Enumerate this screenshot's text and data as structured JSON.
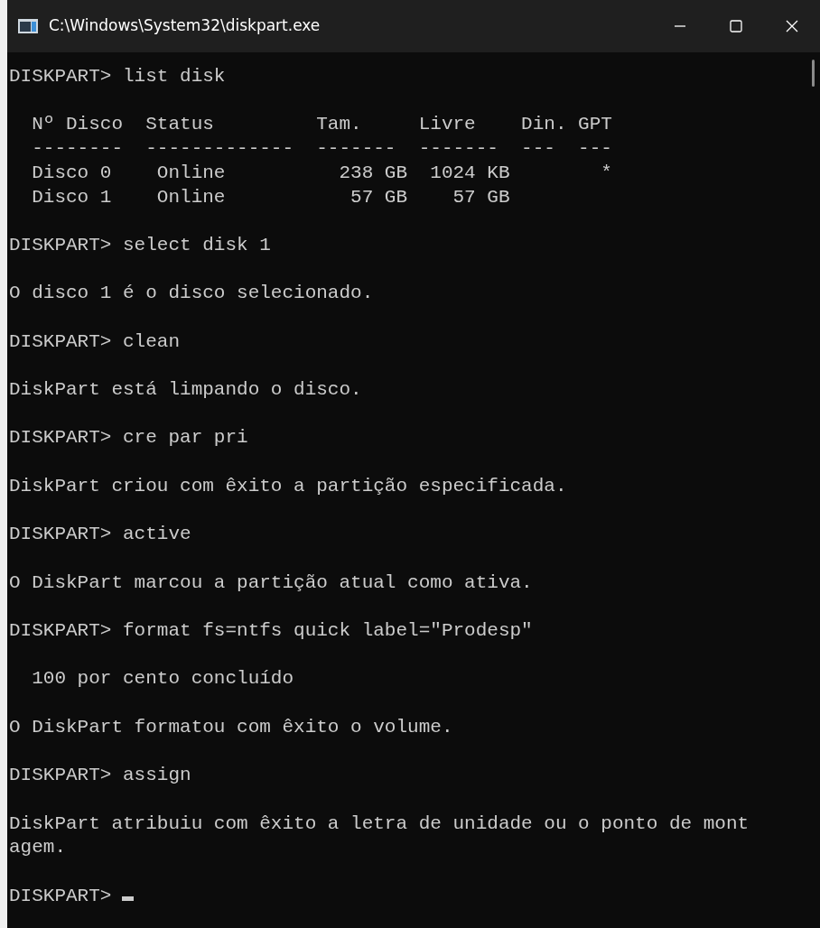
{
  "window": {
    "title": "C:\\Windows\\System32\\diskpart.exe"
  },
  "blocks": [
    {
      "lines": [
        "DISKPART> list disk"
      ]
    },
    {
      "lines": [
        "  Nº Disco  Status         Tam.     Livre    Din. GPT",
        "  --------  -------------  -------  -------  ---  ---",
        "  Disco 0    Online          238 GB  1024 KB        *",
        "  Disco 1    Online           57 GB    57 GB"
      ]
    },
    {
      "lines": [
        "DISKPART> select disk 1"
      ]
    },
    {
      "lines": [
        "O disco 1 é o disco selecionado."
      ]
    },
    {
      "lines": [
        "DISKPART> clean"
      ]
    },
    {
      "lines": [
        "DiskPart está limpando o disco."
      ]
    },
    {
      "lines": [
        "DISKPART> cre par pri"
      ]
    },
    {
      "lines": [
        "DiskPart criou com êxito a partição especificada."
      ]
    },
    {
      "lines": [
        "DISKPART> active"
      ]
    },
    {
      "lines": [
        "O DiskPart marcou a partição atual como ativa."
      ]
    },
    {
      "lines": [
        "DISKPART> format fs=ntfs quick label=\"Prodesp\""
      ]
    },
    {
      "lines": [
        "  100 por cento concluído"
      ]
    },
    {
      "lines": [
        "O DiskPart formatou com êxito o volume."
      ]
    },
    {
      "lines": [
        "DISKPART> assign"
      ]
    },
    {
      "lines": [
        "DiskPart atribuiu com êxito a letra de unidade ou o ponto de mont",
        "agem."
      ]
    }
  ],
  "prompt": {
    "text": "DISKPART>",
    "cursor": true
  }
}
